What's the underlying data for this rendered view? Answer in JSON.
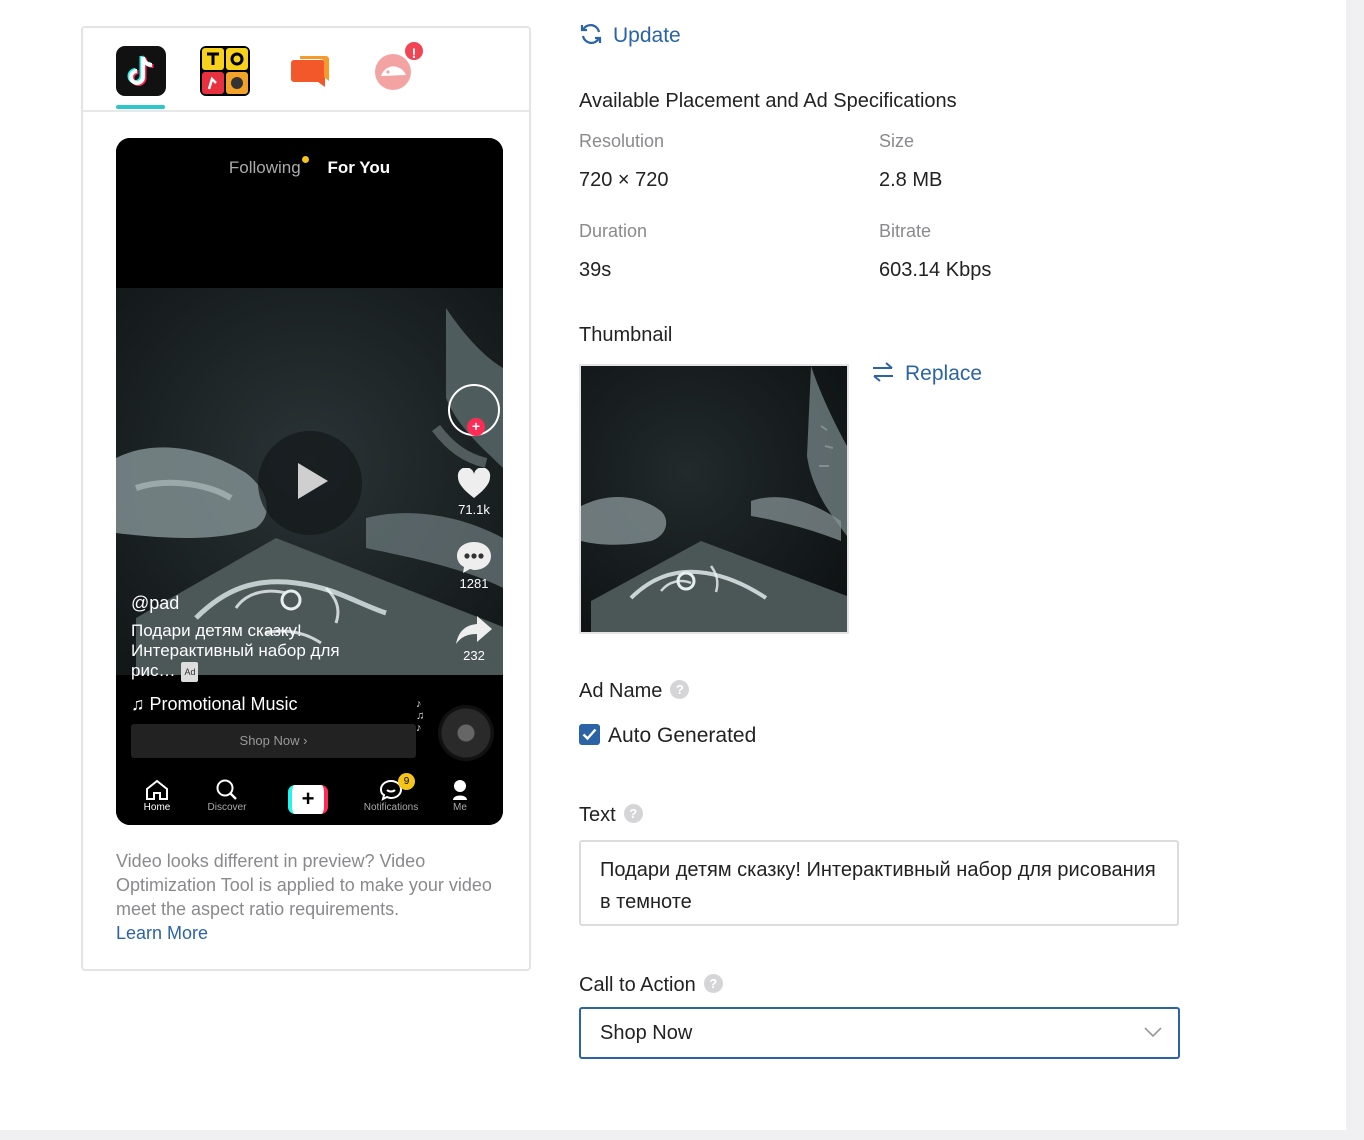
{
  "preview": {
    "app_tabs": [
      {
        "name": "TikTok"
      },
      {
        "name": "TopBuzz"
      },
      {
        "name": "BuzzVideo"
      },
      {
        "name": "Pangle"
      }
    ],
    "alert_badge": "!",
    "feed_tabs": {
      "following": "Following",
      "for_you": "For You"
    },
    "counts": {
      "likes": "71.1k",
      "comments": "1281",
      "shares": "232"
    },
    "caption": {
      "username": "@pad",
      "text_line1": "Подари детям сказку!",
      "text_line2": "Интерактивный набор для",
      "text_line3": "рис…",
      "ad_label": "Ad"
    },
    "music": "♫ Promotional Music",
    "shop_button": "Shop Now ›",
    "nav": {
      "home": "Home",
      "discover": "Discover",
      "plus": "+",
      "notifications": "Notifications",
      "notifications_badge": "9",
      "me": "Me"
    },
    "note": "Video looks different in preview? Video Optimization Tool is applied to make your video meet the aspect ratio requirements.",
    "learn_more": "Learn More"
  },
  "details": {
    "update_label": "Update",
    "placement_title": "Available Placement and Ad Specifications",
    "specs": {
      "resolution_label": "Resolution",
      "resolution_value": "720 × 720",
      "size_label": "Size",
      "size_value": "2.8 MB",
      "duration_label": "Duration",
      "duration_value": "39s",
      "bitrate_label": "Bitrate",
      "bitrate_value": "603.14 Kbps"
    },
    "thumbnail_title": "Thumbnail",
    "replace_label": "Replace",
    "ad_name_label": "Ad Name",
    "auto_generated_label": "Auto Generated",
    "auto_generated_checked": true,
    "text_label": "Text",
    "text_value": "Подари детям сказку! Интерактивный набор для рисования в темноте",
    "cta_label": "Call to Action",
    "cta_value": "Shop Now",
    "help_glyph": "?"
  },
  "colors": {
    "link": "#2b64a6",
    "tab_underline": "#2ec7c9",
    "alert": "#f04553",
    "tiktok_red": "#fe2c55",
    "tiktok_cyan": "#25f4ee"
  }
}
